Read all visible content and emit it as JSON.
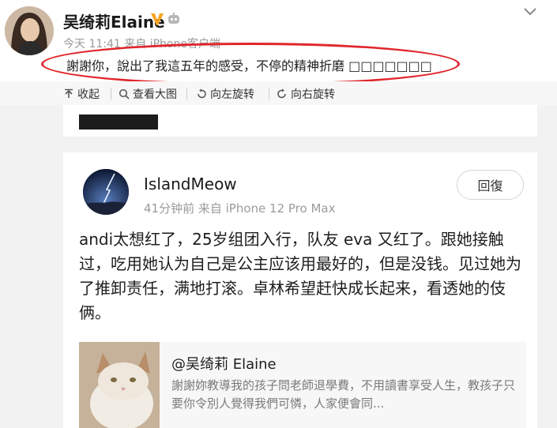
{
  "post": {
    "author": "吴绮莉Elaine",
    "meta": "今天 11:41 来自 iPhone客户端",
    "text": "謝謝你，說出了我這五年的感受，不停的精神折磨 □□□□□□□",
    "icons": [
      "verified-v-icon",
      "robot-icon",
      "chevron-down-icon"
    ],
    "colors": {
      "highlight": "#e0262c",
      "verified": "#f5a623"
    }
  },
  "toolbar": {
    "collapse": "收起",
    "view_large": "查看大图",
    "rotate_left": "向左旋转",
    "rotate_right": "向右旋转"
  },
  "comment": {
    "author": "IslandMeow",
    "meta": "41分钟前  来自 iPhone 12 Pro Max",
    "reply_label": "回復",
    "text": "andi太想红了，25岁组团入行，队友 eva 又红了。跟她接触过，吃用她认为自己是公主应该用最好的，但是没钱。见过她为了推卸责任，满地打滚。卓林希望赶快成长起来，看透她的伎俩。",
    "quote": {
      "author": "@吴绮莉 Elaine",
      "text": "謝謝妳教導我的孩子問老師退學費，不用讀書享受人生，教孩子只要你令別人覺得我們可憐，人家便會同..."
    }
  }
}
